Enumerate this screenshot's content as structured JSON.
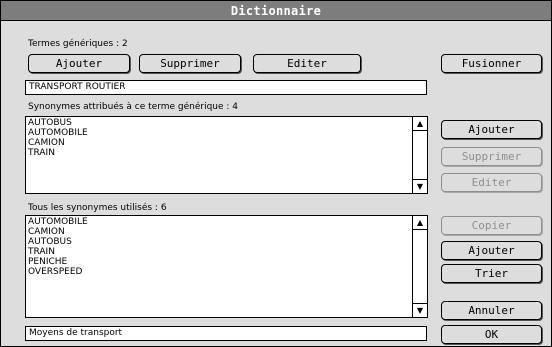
{
  "window": {
    "title": "Dictionnaire"
  },
  "generic_terms": {
    "label": "Termes génériques : 2",
    "add_button": "Ajouter",
    "delete_button": "Supprimer",
    "edit_button": "Editer",
    "current_value": "TRANSPORT ROUTIER"
  },
  "merge_button": "Fusionner",
  "assigned_synonyms": {
    "label": "Synonymes attribués à ce terme générique : 4",
    "items": [
      "AUTOBUS",
      "AUTOMOBILE",
      "CAMION",
      "TRAIN"
    ],
    "add_button": "Ajouter",
    "delete_button": "Supprimer",
    "edit_button": "Editer"
  },
  "all_synonyms": {
    "label": "Tous les synonymes utilisés : 6",
    "items": [
      "AUTOMOBILE",
      "CAMION",
      "AUTOBUS",
      "TRAIN",
      "PENICHE",
      "OVERSPEED"
    ],
    "copy_button": "Copier",
    "add_button": "Ajouter",
    "sort_button": "Trier"
  },
  "description_value": "Moyens de transport",
  "cancel_button": "Annuler",
  "ok_button": "OK",
  "icons": {
    "scroll_up": "scroll-up-arrow-icon",
    "scroll_down": "scroll-down-arrow-icon"
  }
}
